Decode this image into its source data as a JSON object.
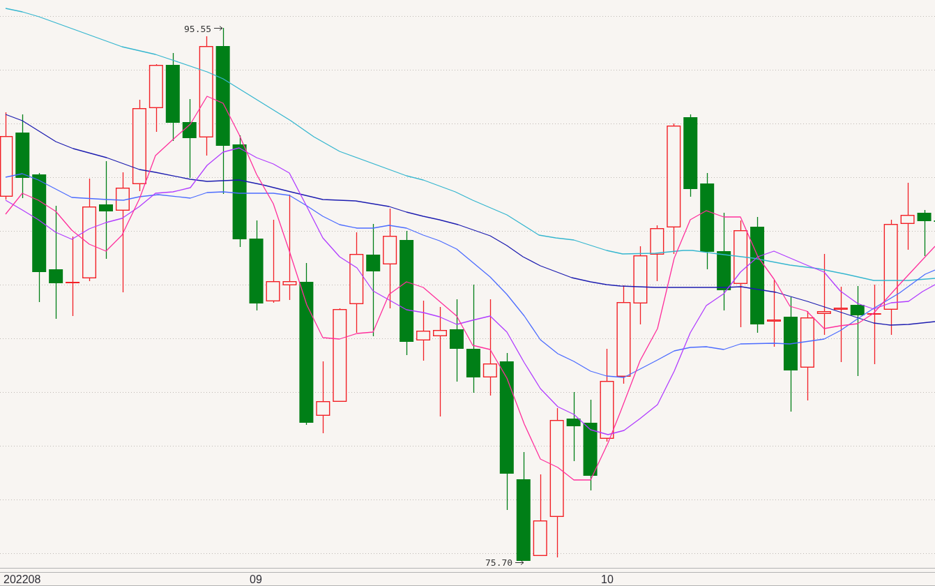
{
  "chart": {
    "high_label": "95.55",
    "low_label": "75.70"
  },
  "time_axis": {
    "labels": [
      "202208",
      "09",
      "10"
    ]
  }
}
